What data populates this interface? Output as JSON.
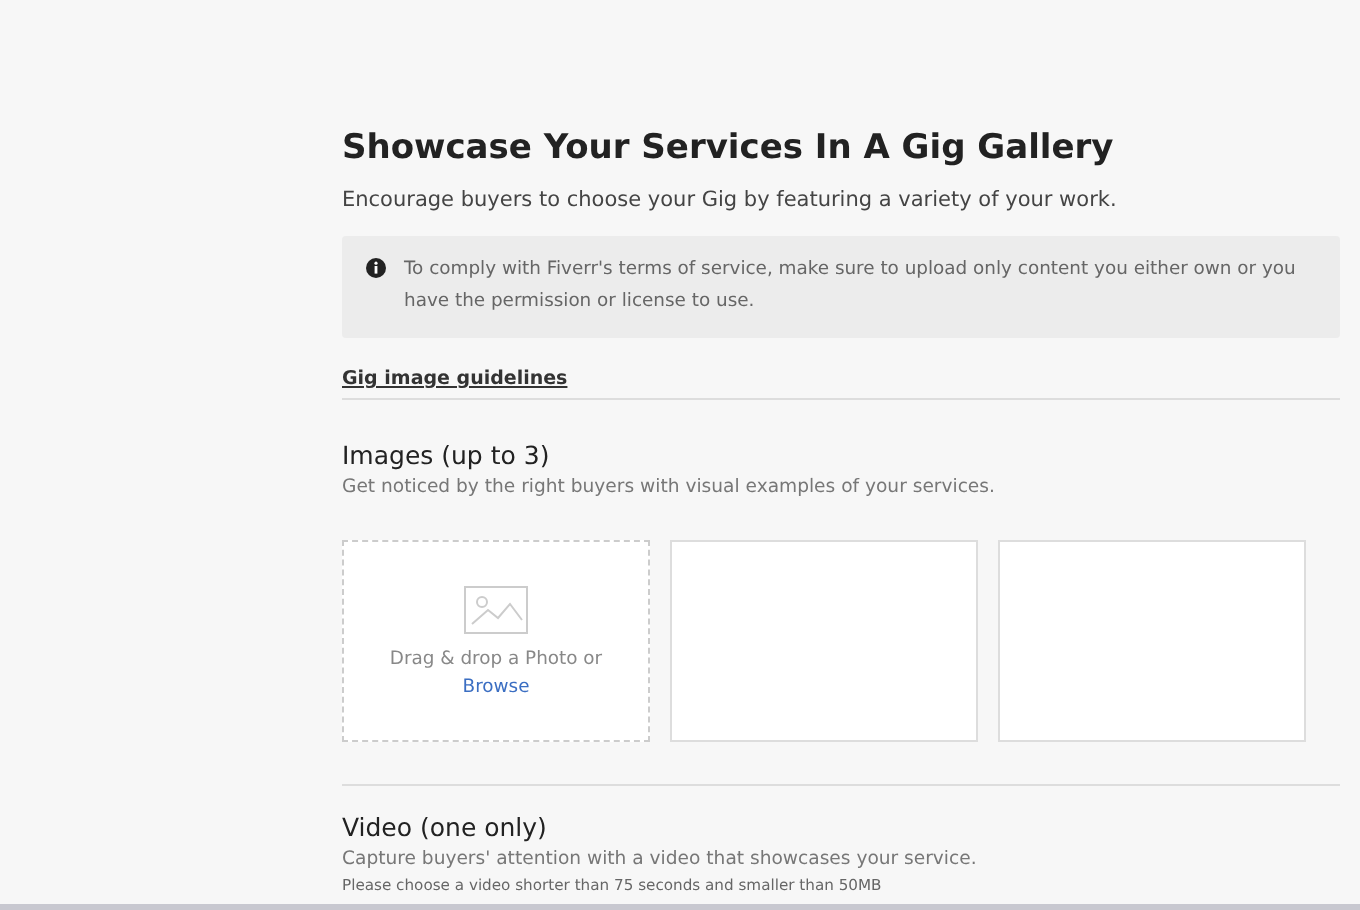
{
  "title": "Showcase Your Services In A Gig Gallery",
  "subtitle": "Encourage buyers to choose your Gig by featuring a variety of your work.",
  "notice": "To comply with Fiverr's terms of service, make sure to upload only content you either own or you have the permission or license to use.",
  "guidelines_link": "Gig image guidelines",
  "images": {
    "heading": "Images (up to 3)",
    "description": "Get noticed by the right buyers with visual examples of your services.",
    "slots": [
      {
        "kind": "upload",
        "prompt": "Drag & drop a Photo or",
        "link": "Browse"
      },
      {
        "kind": "empty"
      },
      {
        "kind": "empty"
      }
    ]
  },
  "video": {
    "heading": "Video (one only)",
    "description": "Capture buyers' attention with a video that showcases your service.",
    "note": "Please choose a video shorter than 75 seconds and smaller than 50MB"
  }
}
